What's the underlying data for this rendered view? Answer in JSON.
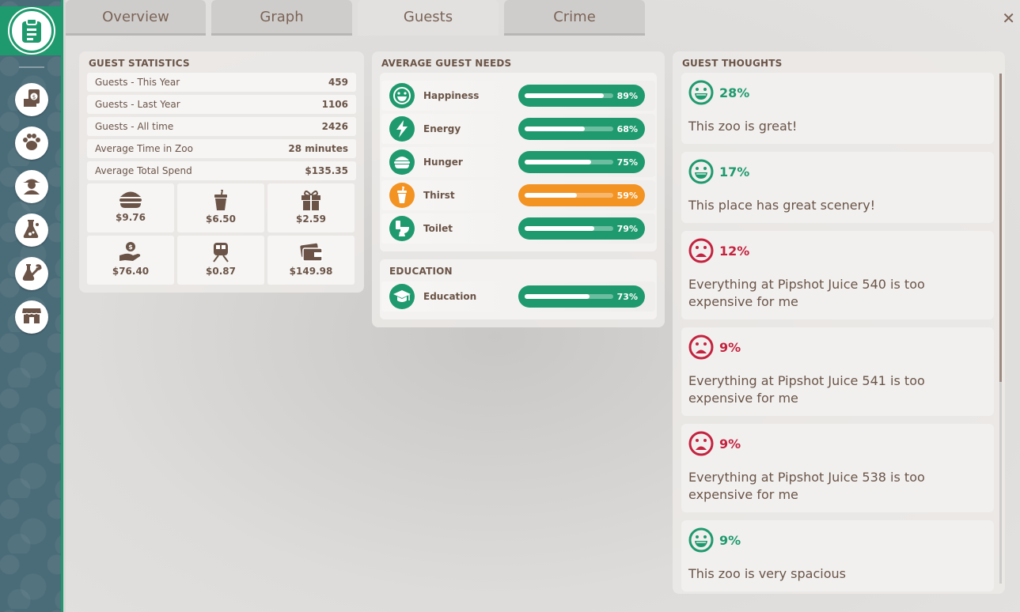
{
  "tabs": [
    {
      "label": "Overview",
      "active": false
    },
    {
      "label": "Graph",
      "active": false
    },
    {
      "label": "Guests",
      "active": true
    },
    {
      "label": "Crime",
      "active": false
    }
  ],
  "close_label": "✕",
  "sidebar_icons": [
    "clipboard-icon",
    "finance-icon",
    "paw-icon",
    "staff-icon",
    "research-icon",
    "maintenance-icon",
    "shop-icon"
  ],
  "guest_statistics": {
    "title": "GUEST STATISTICS",
    "rows": [
      {
        "label": "Guests - This Year",
        "value": "459"
      },
      {
        "label": "Guests - Last Year",
        "value": "1106"
      },
      {
        "label": "Guests - All time",
        "value": "2426"
      },
      {
        "label": "Average Time in Zoo",
        "value": "28 minutes"
      },
      {
        "label": "Average Total Spend",
        "value": "$135.35"
      }
    ],
    "spending": [
      {
        "icon": "burger-icon",
        "value": "$9.76"
      },
      {
        "icon": "drink-cup-icon",
        "value": "$6.50"
      },
      {
        "icon": "gift-icon",
        "value": "$2.59"
      },
      {
        "icon": "donation-hand-icon",
        "value": "$76.40"
      },
      {
        "icon": "train-icon",
        "value": "$0.87"
      },
      {
        "icon": "wallet-icon",
        "value": "$149.98"
      }
    ]
  },
  "needs": {
    "title": "AVERAGE GUEST NEEDS",
    "items": [
      {
        "label": "Happiness",
        "icon": "happy-face-icon",
        "value": 89,
        "display": "89%",
        "color": "#1f9a6e"
      },
      {
        "label": "Energy",
        "icon": "lightning-icon",
        "value": 68,
        "display": "68%",
        "color": "#1f9a6e"
      },
      {
        "label": "Hunger",
        "icon": "burger-icon",
        "value": 75,
        "display": "75%",
        "color": "#1f9a6e"
      },
      {
        "label": "Thirst",
        "icon": "drink-cup-icon",
        "value": 59,
        "display": "59%",
        "color": "#f39321"
      },
      {
        "label": "Toilet",
        "icon": "toilet-icon",
        "value": 79,
        "display": "79%",
        "color": "#1f9a6e"
      }
    ]
  },
  "education": {
    "title": "EDUCATION",
    "items": [
      {
        "label": "Education",
        "icon": "graduation-cap-icon",
        "value": 73,
        "display": "73%",
        "color": "#1f9a6e"
      }
    ]
  },
  "thoughts": {
    "title": "GUEST THOUGHTS",
    "items": [
      {
        "mood": "happy",
        "percent": "28%",
        "text": "This zoo is great!"
      },
      {
        "mood": "happy",
        "percent": "17%",
        "text": "This place has great scenery!"
      },
      {
        "mood": "sad",
        "percent": "12%",
        "text": "Everything at Pipshot Juice 540 is too expensive for me"
      },
      {
        "mood": "sad",
        "percent": "9%",
        "text": "Everything at Pipshot Juice 541 is too expensive for me"
      },
      {
        "mood": "sad",
        "percent": "9%",
        "text": "Everything at Pipshot Juice 538 is too expensive for me"
      },
      {
        "mood": "happy",
        "percent": "9%",
        "text": "This zoo is very spacious"
      }
    ]
  },
  "colors": {
    "accent": "#1f9a6e",
    "warning": "#f39321",
    "negative": "#c4233f",
    "text": "#6b5447"
  }
}
